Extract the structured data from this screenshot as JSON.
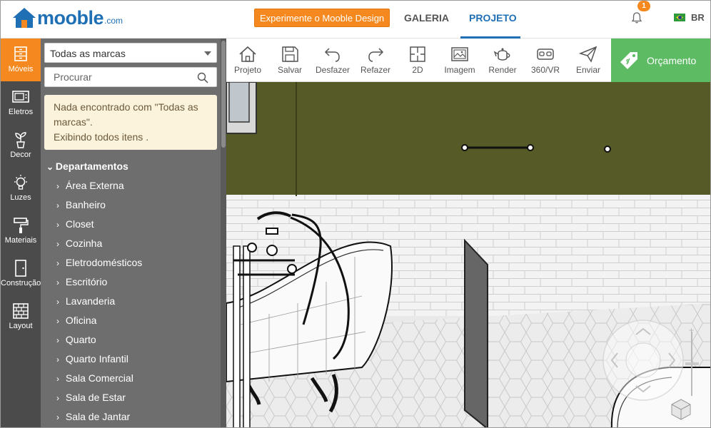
{
  "header": {
    "logo_text": "mooble",
    "logo_suffix": ".com",
    "cta_label": "Experimente o Mooble Design",
    "nav": [
      {
        "label": "GALERIA",
        "active": false
      },
      {
        "label": "PROJETO",
        "active": true
      }
    ],
    "notifications_count": "1",
    "language": "BR",
    "accent_color": "#1f6fb5",
    "cta_color": "#f5891f"
  },
  "rail": {
    "items": [
      {
        "label": "Móveis",
        "icon": "dresser-icon",
        "active": true
      },
      {
        "label": "Eletros",
        "icon": "microwave-icon",
        "active": false
      },
      {
        "label": "Decor",
        "icon": "plant-icon",
        "active": false
      },
      {
        "label": "Luzes",
        "icon": "lightbulb-icon",
        "active": false
      },
      {
        "label": "Materiais",
        "icon": "paint-roller-icon",
        "active": false
      },
      {
        "label": "Construção",
        "icon": "door-icon",
        "active": false
      },
      {
        "label": "Layout",
        "icon": "brick-wall-icon",
        "active": false
      }
    ]
  },
  "catalog": {
    "brand_select_value": "Todas as marcas",
    "search_placeholder": "Procurar",
    "notice_line1": "Nada encontrado com \"Todas as marcas\".",
    "notice_line2": "Exibindo todos itens .",
    "tree_title": "Departamentos",
    "departments": [
      "Área Externa",
      "Banheiro",
      "Closet",
      "Cozinha",
      "Eletrodomésticos",
      "Escritório",
      "Lavanderia",
      "Oficina",
      "Quarto",
      "Quarto Infantil",
      "Sala Comercial",
      "Sala de Estar",
      "Sala de Jantar"
    ]
  },
  "toolbar": {
    "tools": [
      {
        "label": "Projeto",
        "icon": "home-icon"
      },
      {
        "label": "Salvar",
        "icon": "save-icon"
      },
      {
        "label": "Desfazer",
        "icon": "undo-icon"
      },
      {
        "label": "Refazer",
        "icon": "redo-icon"
      },
      {
        "label": "2D",
        "icon": "floorplan-icon"
      },
      {
        "label": "Imagem",
        "icon": "image-icon"
      },
      {
        "label": "Render",
        "icon": "teapot-icon"
      },
      {
        "label": "360/VR",
        "icon": "vr-headset-icon"
      },
      {
        "label": "Enviar",
        "icon": "send-icon"
      }
    ],
    "budget_label": "Orçamento",
    "budget_color": "#5dbb63"
  }
}
